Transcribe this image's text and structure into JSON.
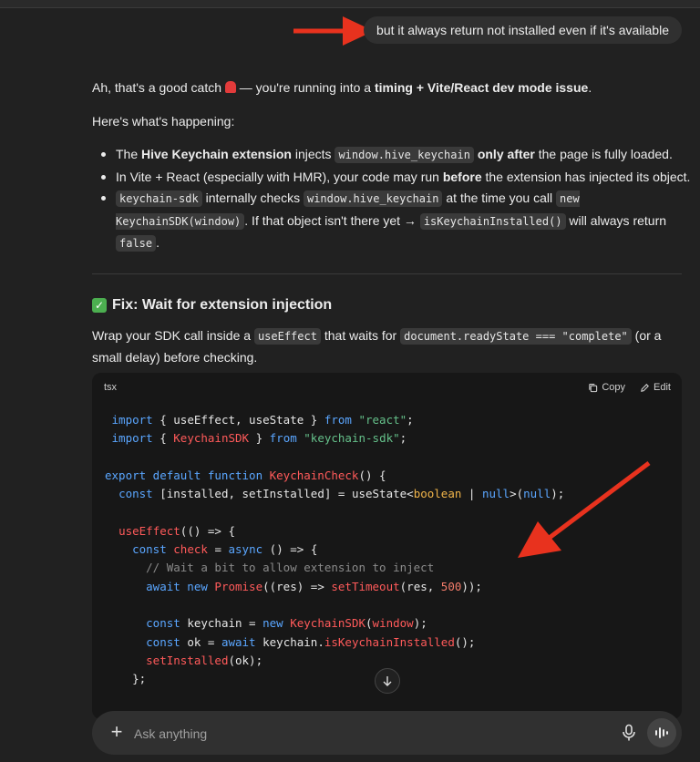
{
  "user_message": "but it always return not installed even if it's available",
  "reply": {
    "intro_pre": "Ah, that's a good catch ",
    "intro_mid": " — you're running into a ",
    "intro_bold": "timing + Vite/React dev mode issue",
    "intro_post": ".",
    "whats_happening": "Here's what's happening:",
    "b1": {
      "pre": "The ",
      "bold1": "Hive Keychain extension",
      "mid": " injects ",
      "code": "window.hive_keychain",
      "bold2": " only after",
      "post": " the page is fully loaded."
    },
    "b2": {
      "pre": "In Vite + React (especially with HMR), your code may run ",
      "bold": "before",
      "post": " the extension has injected its object."
    },
    "b3": {
      "code1": "keychain-sdk",
      "t1": " internally checks ",
      "code2": "window.hive_keychain",
      "t2": " at the time you call ",
      "code3": "new KeychainSDK(window)",
      "t3": ". If that object isn't there yet → ",
      "code4": "isKeychainInstalled()",
      "t4": " will always return ",
      "code5": "false",
      "t5": "."
    },
    "fix_heading": "Fix: Wait for extension injection",
    "wrap_pre": "Wrap your SDK call inside a ",
    "wrap_code1": "useEffect",
    "wrap_mid": " that waits for ",
    "wrap_code2": "document.readyState === \"complete\"",
    "wrap_post": " (or a small delay) before checking."
  },
  "code_block": {
    "language": "tsx",
    "copy_label": "Copy",
    "edit_label": "Edit"
  },
  "composer": {
    "placeholder": "Ask anything"
  },
  "colors": {
    "annotation_arrow": "#e8321e"
  }
}
